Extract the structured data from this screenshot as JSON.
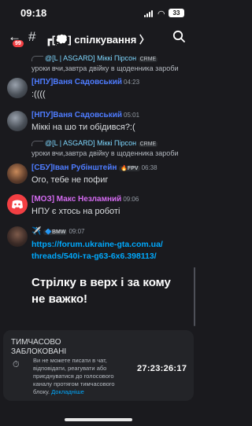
{
  "status": {
    "time": "09:18",
    "battery": "33"
  },
  "header": {
    "unread_badge": "99",
    "channel": "┏[💭] спілкування 〉"
  },
  "messages": [
    {
      "reply_name": "@[L | ASGARD] Міккі Пірсон",
      "reply_tag": "CRME",
      "reply_text": "уроки вчи,завтра двійку в щоденника зароби"
    },
    {
      "author": "[НПУ]Ваня Садовський",
      "time": "04:23",
      "text": ":((((",
      "color": "#4e7cff"
    },
    {
      "author": "[НПУ]Ваня Садовський",
      "time": "05:01",
      "text": "Міккі на шо ти обідився?:(",
      "color": "#4e7cff"
    },
    {
      "reply_name": "@[L | ASGARD] Міккі Пірсон",
      "reply_tag": "CRME",
      "reply_text": "уроки вчи,завтра двійку в щоденника зароби"
    },
    {
      "author": "[СБУ]Іван Рубінштейн",
      "tag": "🔥FPV",
      "time": "06:38",
      "text": "Ого, тебе не пофиг",
      "color": "#4e7cff"
    },
    {
      "author": "[МОЗ] Макс Незламний",
      "time": "09:06",
      "text": "НПУ є хтось на роботі",
      "color": "#d56bf2"
    },
    {
      "author": "✈️",
      "tag": "🔷BMW",
      "time": "09:07",
      "link_line1": "https://forum.ukraine-gta.com.ua/",
      "link_line2": "threads/540і-та-g63-6х6.398113/",
      "big_line1": "Стрілку в верх і за кому",
      "big_line2": "не важко!"
    }
  ],
  "banner": {
    "title_line1": "ТИМЧАСОВО",
    "title_line2": "ЗАБЛОКОВАНІ",
    "desc": "Ви не можете писати в чат, відповідати, реагувати або приєднуватися до голосового каналу протягом тимчасового блоку.",
    "more": "Докладніше",
    "timer": "27:23:26:17"
  },
  "colors": {
    "background": "#1a1a1e",
    "link": "#00a8fc",
    "reply_name": "#7fd8ff"
  }
}
